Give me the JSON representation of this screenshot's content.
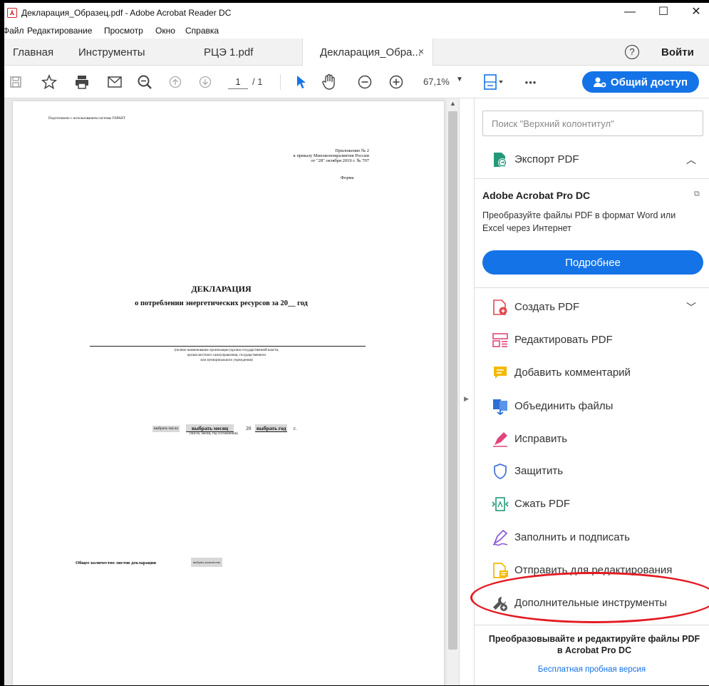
{
  "window": {
    "title": "Декларация_Образец.pdf - Adobe Acrobat Reader DC",
    "minimize": "—",
    "maximize": "☐",
    "close": "✕"
  },
  "menu": [
    "Файл",
    "Редактирование",
    "Просмотр",
    "Окно",
    "Справка"
  ],
  "tabs": {
    "home": "Главная",
    "tools": "Инструменты",
    "doc1": "РЦЭ 1.pdf",
    "doc2": "Декларация_Обра...",
    "close": "×",
    "help": "?",
    "signin": "Войти"
  },
  "toolbar": {
    "page_current": "1",
    "page_total": "/ 1",
    "zoom": "67,1%",
    "more": "•••",
    "share_label": "Общий доступ"
  },
  "document": {
    "prepared": "Подготовлено с использованием системы ГАРАНТ",
    "appendix_line1": "Приложение № 2",
    "appendix_line2": "к приказу Минэкономразвития России",
    "appendix_line3": "от \"28\" октября 2019 г. № 707",
    "form": "Форма",
    "heading": "ДЕКЛАРАЦИЯ",
    "subheading": "о потреблении энергетических ресурсов за 20__ год",
    "org_hint_1": "(полное наименование организации (органа государственной власти,",
    "org_hint_2": "органа местного самоуправления, государственного",
    "org_hint_3": "или муниципального учреждения)",
    "date_day": "выбрать число",
    "date_month": "выбрать месяц",
    "date_20": "20",
    "date_year": "выбрать год",
    "date_g": "г.",
    "date_hint": "(число, месяц, год составления)",
    "sheets_label": "Общее количество листов декларации",
    "sheets_field": "выбрать количество"
  },
  "right_pane": {
    "search_placeholder": "Поиск \"Верхний колонтитул\"",
    "export_pdf": "Экспорт PDF",
    "promo_title": "Adobe Acrobat Pro DC",
    "promo_desc": "Преобразуйте файлы PDF в формат Word или Excel через Интернет",
    "promo_button": "Подробнее",
    "tools": [
      "Создать PDF",
      "Редактировать PDF",
      "Добавить комментарий",
      "Объединить файлы",
      "Исправить",
      "Защитить",
      "Сжать PDF",
      "Заполнить и подписать",
      "Отправить для редактирования",
      "Дополнительные инструменты"
    ],
    "bottom_title": "Преобразовывайте и редактируйте файлы PDF в Acrobat Pro DC",
    "bottom_link": "Бесплатная пробная версия"
  },
  "colors": {
    "accent": "#1473e6",
    "highlight_ring": "#e31b23"
  }
}
